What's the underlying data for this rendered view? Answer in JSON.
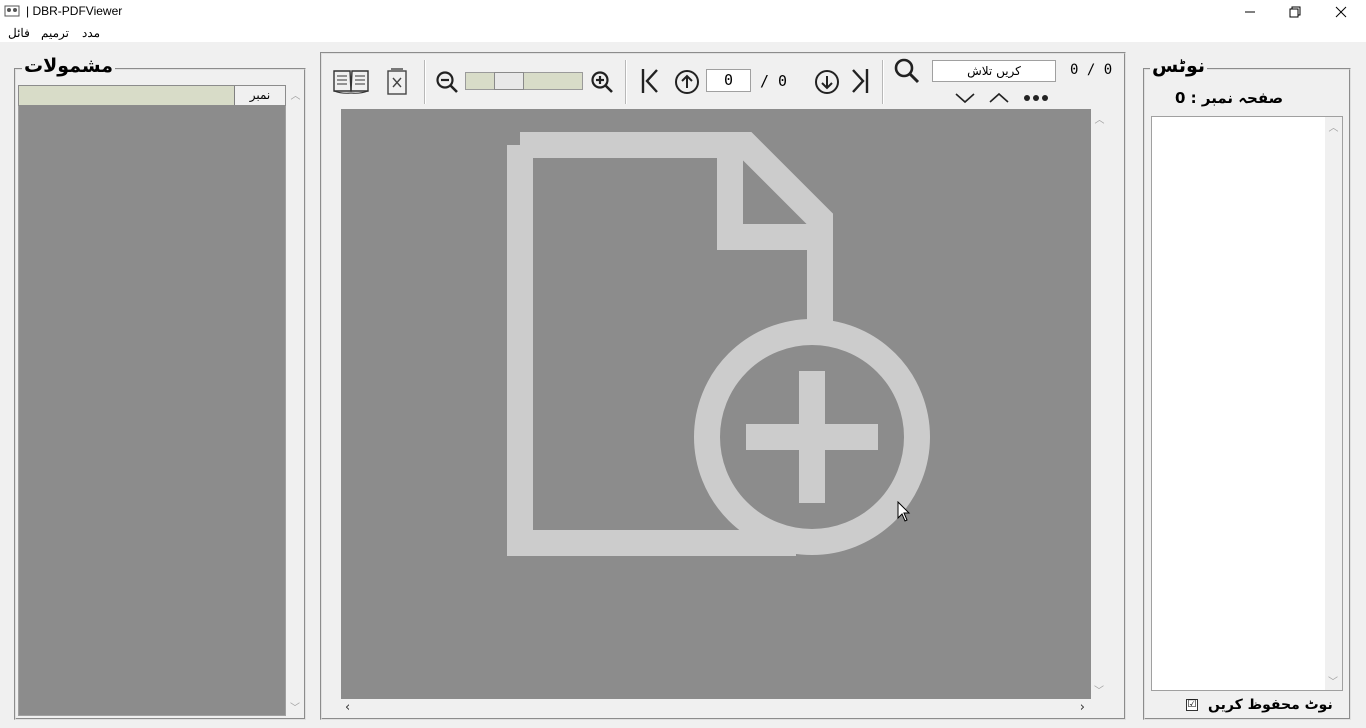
{
  "window": {
    "title": "| DBR-PDFViewer",
    "minimize_icon": "minimize-icon",
    "maximize_icon": "restore-icon",
    "close_icon": "close-icon"
  },
  "menu": {
    "items": [
      "فائل",
      "ترمیم",
      "مدد"
    ]
  },
  "toc_panel": {
    "title": "مشمولات",
    "column_header": "نمبر"
  },
  "toolbar": {
    "page_current": "0",
    "page_total": "/ 0",
    "search_placeholder": "کریں تلاش",
    "search_count": "0 / 0",
    "zoom_level_fraction": 0.33
  },
  "viewer": {
    "placeholder_icon": "add-document-icon"
  },
  "notes_panel": {
    "title": "نوٹس",
    "page_number_label": "صفحہ نمبر : 0",
    "save_notes_label": "نوٹ محفوظ کریں",
    "save_notes_checked": "☑"
  },
  "colors": {
    "viewer_bg": "#8c8c8c",
    "icon_fg": "#cccccc",
    "header_bg": "#d8dcc8"
  }
}
